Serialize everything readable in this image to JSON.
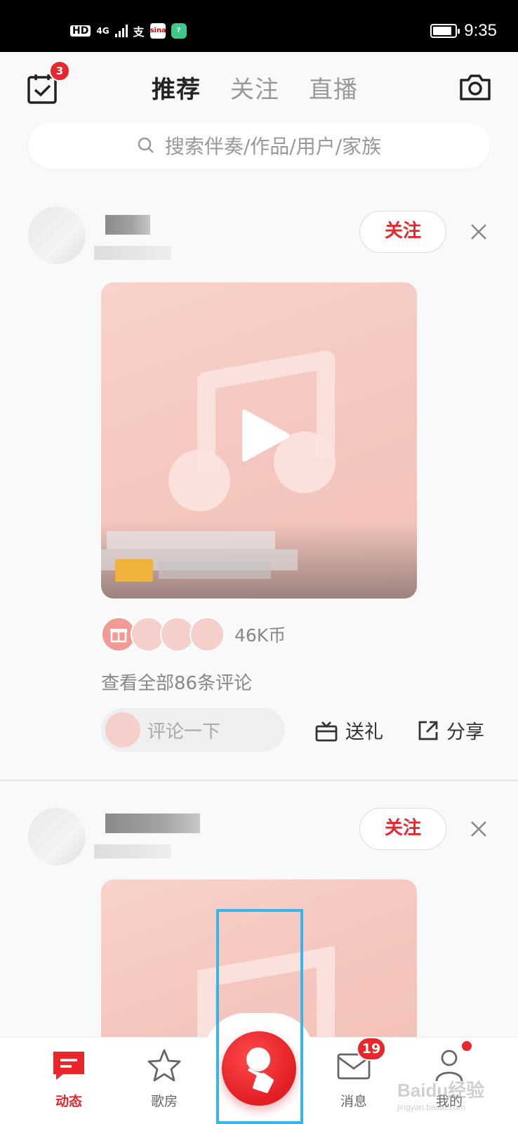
{
  "status_bar": {
    "hd": "HD",
    "network": "4G",
    "time": "9:35",
    "battery_level": 0.85
  },
  "header": {
    "tabs": [
      {
        "label": "推荐",
        "active": true
      },
      {
        "label": "关注",
        "active": false
      },
      {
        "label": "直播",
        "active": false
      }
    ],
    "calendar_badge": "3",
    "icons": {
      "calendar": "calendar-check-icon",
      "camera": "camera-icon"
    }
  },
  "search": {
    "placeholder": "搜索伴奏/作品/用户/家族",
    "icon": "search-icon"
  },
  "feed": [
    {
      "follow_label": "关注",
      "coins": "46K币",
      "comments_link": "查看全部86条评论",
      "comment_placeholder": "评论一下",
      "gift_label": "送礼",
      "share_label": "分享"
    },
    {
      "follow_label": "关注"
    }
  ],
  "bottom_nav": {
    "items": [
      {
        "label": "动态",
        "icon": "chat-bubble-icon",
        "active": true
      },
      {
        "label": "歌房",
        "icon": "star-icon",
        "active": false
      },
      {
        "label": "消息",
        "icon": "mail-icon",
        "active": false
      },
      {
        "label": "我的",
        "icon": "user-icon",
        "active": false
      }
    ],
    "message_badge": "19",
    "center_icon": "microphone-icon"
  },
  "colors": {
    "accent": "#e8262c",
    "highlight": "#35b6e6"
  },
  "watermark": {
    "text": "Baidu经验",
    "url": "jingyan.baidu.com"
  }
}
